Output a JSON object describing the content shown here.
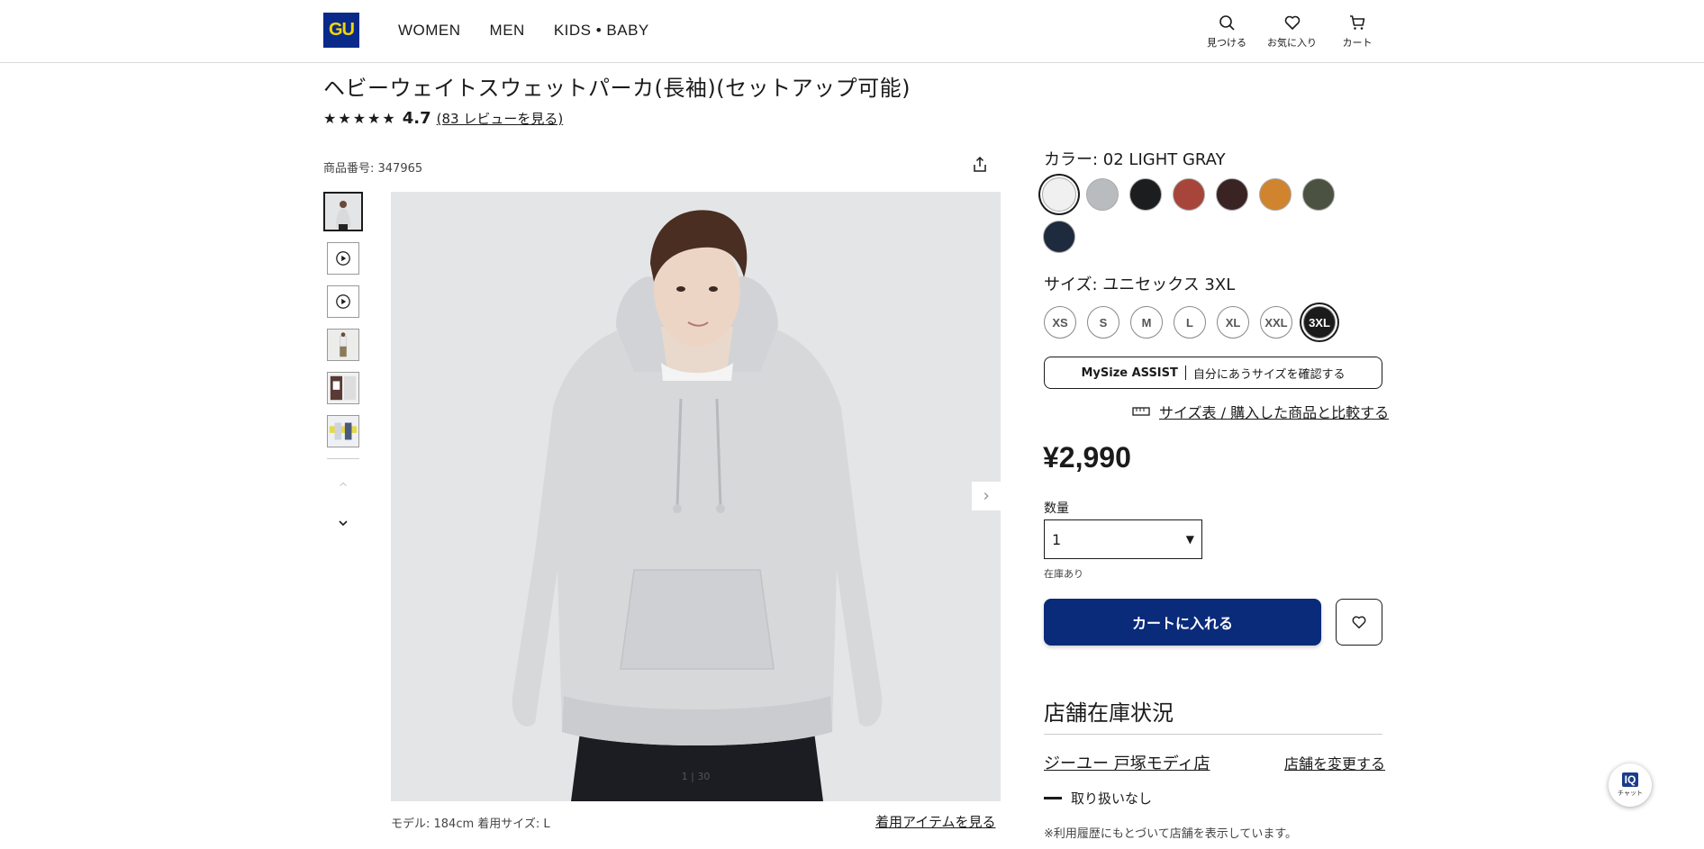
{
  "header": {
    "logo": "GU",
    "nav": [
      "WOMEN",
      "MEN",
      "KIDS • BABY"
    ],
    "icons": [
      {
        "icon": "search-icon",
        "label": "見つける"
      },
      {
        "icon": "heart-icon",
        "label": "お気に入り"
      },
      {
        "icon": "cart-icon",
        "label": "カート"
      }
    ]
  },
  "product": {
    "title": "ヘビーウェイトスウェットパーカ(長袖)(セットアップ可能)",
    "stars": "★★★★★",
    "rating": "4.7",
    "review_link": "(83 レビューを見る)",
    "product_no": "商品番号: 347965"
  },
  "gallery": {
    "counter": "1 | 30",
    "model_info": "モデル: 184cm 着用サイズ: L",
    "view_items": "着用アイテムを見る"
  },
  "color": {
    "label": "カラー:  02 LIGHT GRAY",
    "swatches": [
      "#f0f0f0",
      "#b9bcbf",
      "#1c1d1f",
      "#a7453a",
      "#3a2323",
      "#d0842e",
      "#4b5241",
      "#1e2a3e"
    ],
    "selected_index": 0
  },
  "size": {
    "label": "サイズ:  ユニセックス 3XL",
    "options": [
      "XS",
      "S",
      "M",
      "L",
      "XL",
      "XXL",
      "3XL"
    ],
    "selected": "3XL"
  },
  "mysize": {
    "brand": "MySize ASSIST",
    "text": "自分にあうサイズを確認する"
  },
  "size_chart": "サイズ表 / 購入した商品と比較する",
  "price": "¥2,990",
  "quantity": {
    "label": "数量",
    "value": "1",
    "stock": "在庫あり"
  },
  "actions": {
    "add_to_cart": "カートに入れる"
  },
  "store": {
    "title": "店舗在庫状況",
    "name": "ジーユー 戸塚モディ店",
    "change": "店舗を変更する",
    "status": "取り扱いなし",
    "note": "※利用履歴にもとづいて店舗を表示しています。"
  },
  "chat": {
    "badge": "IQ",
    "label": "チャット"
  },
  "colors": {
    "primary": "#0a2a7a",
    "logo_bg": "#0a2a8a",
    "logo_text": "#f5d600"
  }
}
